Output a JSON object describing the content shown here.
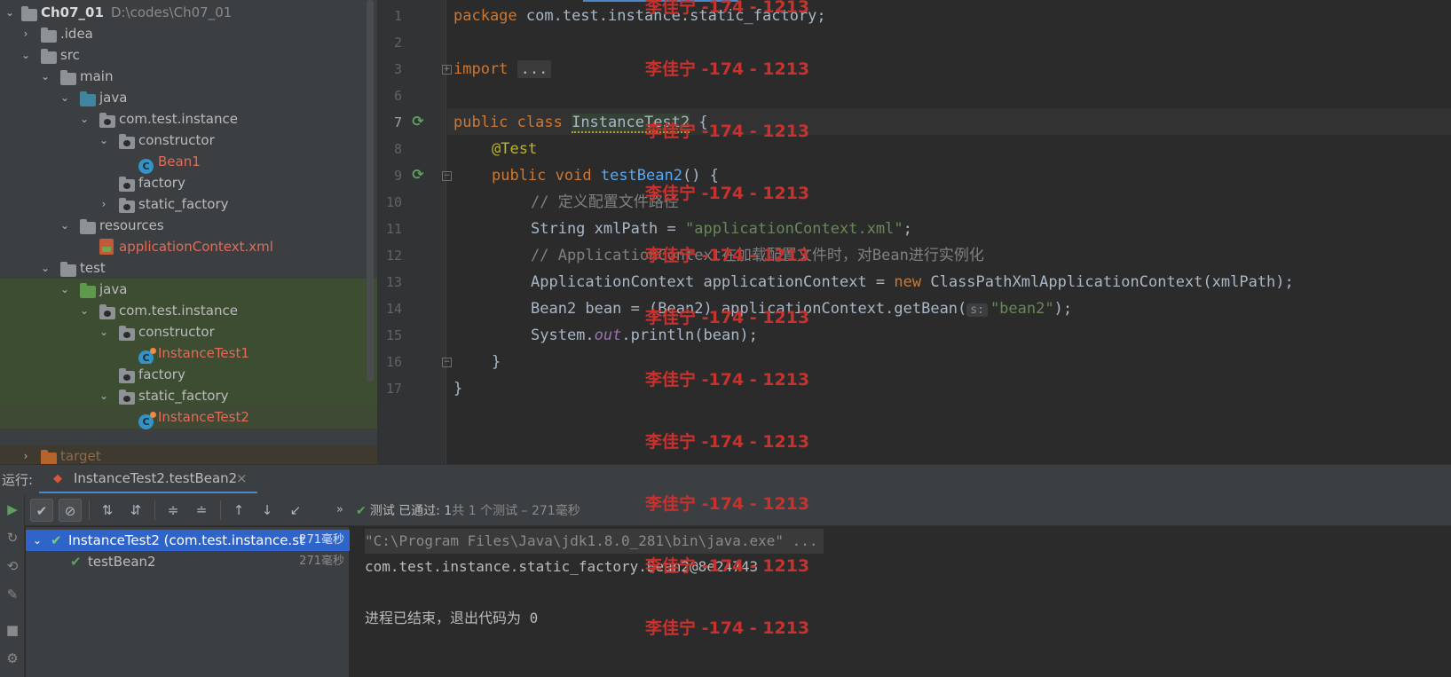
{
  "project_tree": {
    "items": [
      {
        "label": "Ch07_01",
        "path": "D:\\codes\\Ch07_01"
      },
      {
        "label": ".idea"
      },
      {
        "label": "src"
      },
      {
        "label": "main"
      },
      {
        "label": "java"
      },
      {
        "label": "com.test.instance"
      },
      {
        "label": "constructor"
      },
      {
        "label": "Bean1"
      },
      {
        "label": "factory"
      },
      {
        "label": "static_factory"
      },
      {
        "label": "resources"
      },
      {
        "label": "applicationContext.xml"
      },
      {
        "label": "test"
      },
      {
        "label": "java"
      },
      {
        "label": "com.test.instance"
      },
      {
        "label": "constructor"
      },
      {
        "label": "InstanceTest1"
      },
      {
        "label": "factory"
      },
      {
        "label": "static_factory"
      },
      {
        "label": "InstanceTest2"
      },
      {
        "label": "target"
      }
    ]
  },
  "editor": {
    "line_numbers": [
      "1",
      "2",
      "3",
      "6",
      "7",
      "8",
      "9",
      "10",
      "11",
      "12",
      "13",
      "14",
      "15",
      "16",
      "17"
    ],
    "code": {
      "l1_kw": "package",
      "l1_rest": " com.test.instance.static_factory;",
      "l3_kw": "import",
      "l3_collapsed": "...",
      "l7_kw": "public class",
      "l7_class": "InstanceTest2",
      "l7_rest": " {",
      "l8_ann": "@Test",
      "l9_kw": "public void",
      "l9_fn": "testBean2",
      "l9_rest": "() {",
      "l10_cmt": "// 定义配置文件路径",
      "l11_a": "String xmlPath = ",
      "l11_str": "\"applicationContext.xml\"",
      "l11_b": ";",
      "l12_cmt": "// ApplicationContext在加载配置文件时，对Bean进行实例化",
      "l13_a": "ApplicationContext applicationContext = ",
      "l13_kw": "new",
      "l13_b": " ClassPathXmlApplicationContext(xmlPath);",
      "l14_a": "Bean2 bean = (Bean2) applicationContext.getBean(",
      "l14_hint": "s:",
      "l14_str": "\"bean2\"",
      "l14_b": ");",
      "l15_a": "System.",
      "l15_out": "out",
      "l15_b": ".println(bean);",
      "l16": "}",
      "l17": "}"
    }
  },
  "watermark": "李佳宁 -174 - 1213",
  "run_window": {
    "label": "运行:",
    "tab_title": "InstanceTest2.testBean2",
    "tab_close": "×",
    "status_prefix": "测试 已通过: 1",
    "status_rest": "共 1 个测试 – 271毫秒",
    "tests": [
      {
        "name": "InstanceTest2 (com.test.instance.st",
        "time": "271毫秒"
      },
      {
        "name": "testBean2",
        "time": "271毫秒"
      }
    ],
    "console": {
      "cmd": "\"C:\\Program Files\\Java\\jdk1.8.0_281\\bin\\java.exe\" ...",
      "output": "com.test.instance.static_factory.Bean2@8e24743",
      "exit": "进程已结束，退出代码为 0"
    }
  },
  "colors": {
    "keyword": "#cc7832",
    "string": "#6a8759",
    "comment": "#808080",
    "annotation": "#bbb529",
    "function": "#56a8f5",
    "watermark": "#c8322e",
    "pass": "#5ea05f"
  },
  "icons": {
    "run": "play-icon",
    "pass": "check-icon",
    "folder": "folder-icon",
    "class": "java-class-icon"
  }
}
